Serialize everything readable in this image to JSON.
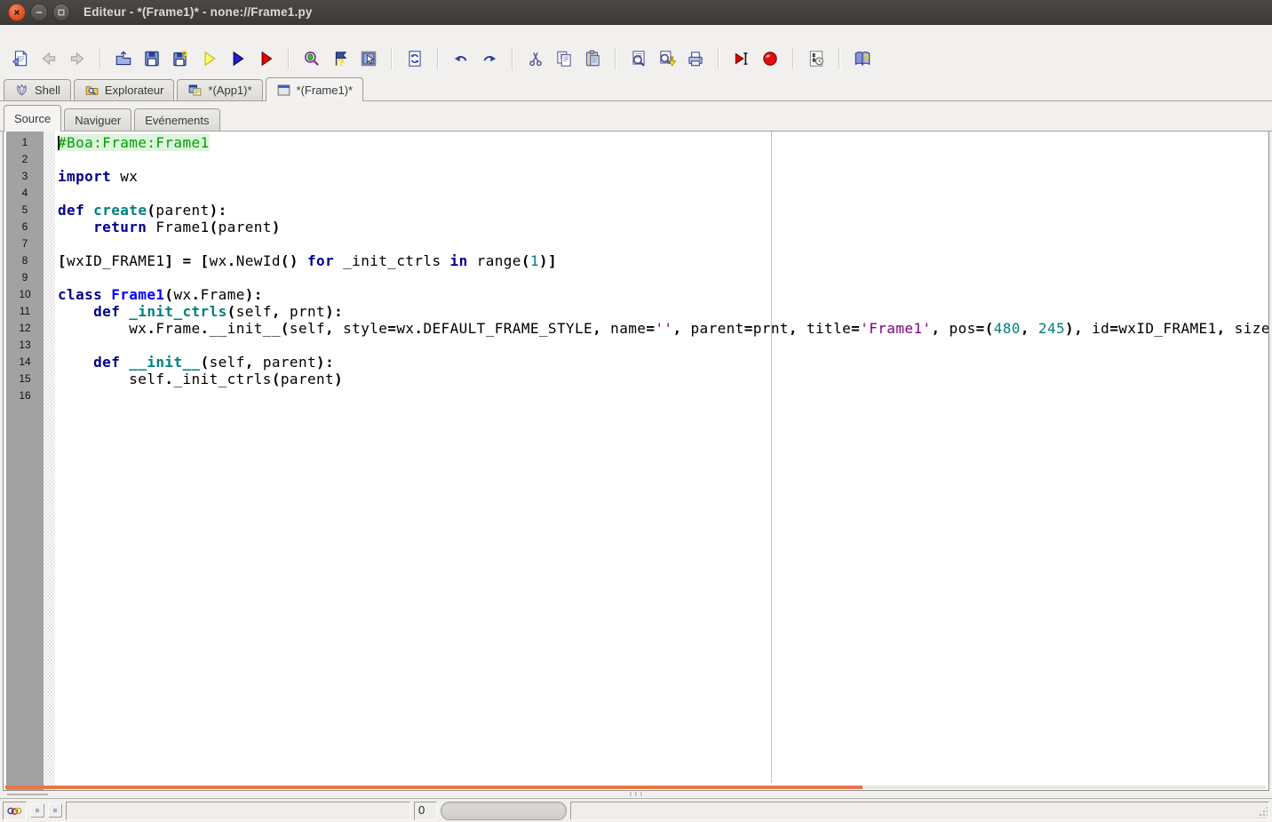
{
  "window": {
    "title": "Editeur - *(Frame1)* - none://Frame1.py",
    "controls": [
      {
        "id": "close"
      },
      {
        "id": "minimize"
      },
      {
        "id": "maximize"
      }
    ]
  },
  "toolbar": {
    "items": [
      {
        "name": "page-setup",
        "icon": "page-setup-icon"
      },
      {
        "name": "back",
        "icon": "back-icon",
        "disabled": true
      },
      {
        "name": "forward",
        "icon": "forward-icon",
        "disabled": true
      },
      {
        "type": "sep"
      },
      {
        "name": "open",
        "icon": "open-icon"
      },
      {
        "name": "save",
        "icon": "save-icon"
      },
      {
        "name": "save-as",
        "icon": "save-as-icon"
      },
      {
        "name": "check-source",
        "icon": "check-source-icon"
      },
      {
        "name": "run-application",
        "icon": "run-app-icon"
      },
      {
        "name": "run-module",
        "icon": "run-module-icon"
      },
      {
        "type": "sep"
      },
      {
        "name": "debug",
        "icon": "debug-icon"
      },
      {
        "name": "debug-post-mortem",
        "icon": "debug-post-mortem-icon"
      },
      {
        "name": "inspect",
        "icon": "inspect-icon"
      },
      {
        "type": "sep"
      },
      {
        "name": "reload",
        "icon": "reload-icon"
      },
      {
        "type": "sep"
      },
      {
        "name": "undo",
        "icon": "undo-icon"
      },
      {
        "name": "redo",
        "icon": "redo-icon"
      },
      {
        "type": "sep"
      },
      {
        "name": "cut",
        "icon": "cut-icon"
      },
      {
        "name": "copy",
        "icon": "copy-icon"
      },
      {
        "name": "paste",
        "icon": "paste-icon"
      },
      {
        "type": "sep"
      },
      {
        "name": "find",
        "icon": "find-icon"
      },
      {
        "name": "find-again",
        "icon": "find-again-icon"
      },
      {
        "name": "print",
        "icon": "print-icon"
      },
      {
        "type": "sep"
      },
      {
        "name": "run-to-cursor",
        "icon": "run-to-cursor-icon"
      },
      {
        "name": "toggle-breakpoint",
        "icon": "toggle-breakpoint-icon"
      },
      {
        "type": "sep"
      },
      {
        "name": "todo-list",
        "icon": "todo-list-icon"
      },
      {
        "type": "sep"
      },
      {
        "name": "help",
        "icon": "help-icon"
      }
    ]
  },
  "tabs": {
    "main": [
      {
        "id": "shell",
        "label": "Shell",
        "icon": "shell-icon",
        "active": false
      },
      {
        "id": "explorateur",
        "label": "Explorateur",
        "icon": "explorer-icon",
        "active": false
      },
      {
        "id": "app1",
        "label": "*(App1)*",
        "icon": "app-icon",
        "active": false
      },
      {
        "id": "frame1",
        "label": "*(Frame1)*",
        "icon": "frame-icon",
        "active": true
      }
    ],
    "sub": [
      {
        "id": "source",
        "label": "Source",
        "active": true
      },
      {
        "id": "naviguer",
        "label": "Naviguer",
        "active": false
      },
      {
        "id": "evenements",
        "label": "Evénements",
        "active": false
      }
    ]
  },
  "editor": {
    "edge_column": 80,
    "lines": [
      {
        "num": 1,
        "caret": true,
        "segments": [
          {
            "t": "#Boa:Frame:Frame1",
            "c": "c"
          }
        ]
      },
      {
        "num": 2,
        "segments": []
      },
      {
        "num": 3,
        "segments": [
          {
            "t": "import",
            "c": "k"
          },
          {
            "t": " wx",
            "c": "t"
          }
        ]
      },
      {
        "num": 4,
        "segments": []
      },
      {
        "num": 5,
        "segments": [
          {
            "t": "def",
            "c": "k"
          },
          {
            "t": " ",
            "c": "t"
          },
          {
            "t": "create",
            "c": "d"
          },
          {
            "t": "(",
            "c": "o"
          },
          {
            "t": "parent",
            "c": "t"
          },
          {
            "t": "):",
            "c": "o"
          }
        ]
      },
      {
        "num": 6,
        "segments": [
          {
            "t": "    ",
            "c": "t"
          },
          {
            "t": "return",
            "c": "k"
          },
          {
            "t": " Frame1",
            "c": "t"
          },
          {
            "t": "(",
            "c": "o"
          },
          {
            "t": "parent",
            "c": "t"
          },
          {
            "t": ")",
            "c": "o"
          }
        ]
      },
      {
        "num": 7,
        "segments": []
      },
      {
        "num": 8,
        "segments": [
          {
            "t": "[",
            "c": "o"
          },
          {
            "t": "wxID_FRAME1",
            "c": "t"
          },
          {
            "t": "] = [",
            "c": "o"
          },
          {
            "t": "wx",
            "c": "t"
          },
          {
            "t": ".",
            "c": "o"
          },
          {
            "t": "NewId",
            "c": "t"
          },
          {
            "t": "() ",
            "c": "o"
          },
          {
            "t": "for",
            "c": "k"
          },
          {
            "t": " _init_ctrls ",
            "c": "t"
          },
          {
            "t": "in",
            "c": "k"
          },
          {
            "t": " range",
            "c": "t"
          },
          {
            "t": "(",
            "c": "o"
          },
          {
            "t": "1",
            "c": "n"
          },
          {
            "t": ")]",
            "c": "o"
          }
        ]
      },
      {
        "num": 9,
        "segments": []
      },
      {
        "num": 10,
        "segments": [
          {
            "t": "class",
            "c": "k"
          },
          {
            "t": " ",
            "c": "t"
          },
          {
            "t": "Frame1",
            "c": "cn"
          },
          {
            "t": "(",
            "c": "o"
          },
          {
            "t": "wx",
            "c": "t"
          },
          {
            "t": ".",
            "c": "o"
          },
          {
            "t": "Frame",
            "c": "t"
          },
          {
            "t": "):",
            "c": "o"
          }
        ]
      },
      {
        "num": 11,
        "segments": [
          {
            "t": "    ",
            "c": "t"
          },
          {
            "t": "def",
            "c": "k"
          },
          {
            "t": " ",
            "c": "t"
          },
          {
            "t": "_init_ctrls",
            "c": "d"
          },
          {
            "t": "(",
            "c": "o"
          },
          {
            "t": "self",
            "c": "t"
          },
          {
            "t": ", ",
            "c": "o"
          },
          {
            "t": "prnt",
            "c": "t"
          },
          {
            "t": "):",
            "c": "o"
          }
        ]
      },
      {
        "num": 12,
        "segments": [
          {
            "t": "        wx",
            "c": "t"
          },
          {
            "t": ".",
            "c": "o"
          },
          {
            "t": "Frame",
            "c": "t"
          },
          {
            "t": ".",
            "c": "o"
          },
          {
            "t": "__init__",
            "c": "t"
          },
          {
            "t": "(",
            "c": "o"
          },
          {
            "t": "self",
            "c": "t"
          },
          {
            "t": ", ",
            "c": "o"
          },
          {
            "t": "style",
            "c": "t"
          },
          {
            "t": "=",
            "c": "o"
          },
          {
            "t": "wx",
            "c": "t"
          },
          {
            "t": ".",
            "c": "o"
          },
          {
            "t": "DEFAULT_FRAME_STYLE",
            "c": "t"
          },
          {
            "t": ", ",
            "c": "o"
          },
          {
            "t": "name",
            "c": "t"
          },
          {
            "t": "=",
            "c": "o"
          },
          {
            "t": "''",
            "c": "s"
          },
          {
            "t": ", ",
            "c": "o"
          },
          {
            "t": "parent",
            "c": "t"
          },
          {
            "t": "=",
            "c": "o"
          },
          {
            "t": "prnt",
            "c": "t"
          },
          {
            "t": ", ",
            "c": "o"
          },
          {
            "t": "title",
            "c": "t"
          },
          {
            "t": "=",
            "c": "o"
          },
          {
            "t": "'Frame1'",
            "c": "s"
          },
          {
            "t": ", ",
            "c": "o"
          },
          {
            "t": "pos",
            "c": "t"
          },
          {
            "t": "=(",
            "c": "o"
          },
          {
            "t": "480",
            "c": "n"
          },
          {
            "t": ", ",
            "c": "o"
          },
          {
            "t": "245",
            "c": "n"
          },
          {
            "t": "), ",
            "c": "o"
          },
          {
            "t": "id",
            "c": "t"
          },
          {
            "t": "=",
            "c": "o"
          },
          {
            "t": "wxID_FRAME1",
            "c": "t"
          },
          {
            "t": ", ",
            "c": "o"
          },
          {
            "t": "size",
            "c": "t"
          }
        ]
      },
      {
        "num": 13,
        "segments": []
      },
      {
        "num": 14,
        "segments": [
          {
            "t": "    ",
            "c": "t"
          },
          {
            "t": "def",
            "c": "k"
          },
          {
            "t": " ",
            "c": "t"
          },
          {
            "t": "__init__",
            "c": "d"
          },
          {
            "t": "(",
            "c": "o"
          },
          {
            "t": "self",
            "c": "t"
          },
          {
            "t": ", ",
            "c": "o"
          },
          {
            "t": "parent",
            "c": "t"
          },
          {
            "t": "):",
            "c": "o"
          }
        ]
      },
      {
        "num": 15,
        "segments": [
          {
            "t": "        self",
            "c": "t"
          },
          {
            "t": ".",
            "c": "o"
          },
          {
            "t": "_init_ctrls",
            "c": "t"
          },
          {
            "t": "(",
            "c": "o"
          },
          {
            "t": "parent",
            "c": "t"
          },
          {
            "t": ")",
            "c": "o"
          }
        ]
      },
      {
        "num": 16,
        "segments": []
      }
    ]
  },
  "statusbar": {
    "counter": "0",
    "buttons": [
      {
        "id": "prev"
      },
      {
        "id": "next"
      }
    ]
  },
  "colors": {
    "scrollbar_orange": "#E8744B",
    "comment_green": "#00A000",
    "keyword_blue": "#00008B",
    "string_magenta": "#7F007F",
    "number_teal": "#007F7F",
    "gutter_gray": "#A2A2A2"
  }
}
